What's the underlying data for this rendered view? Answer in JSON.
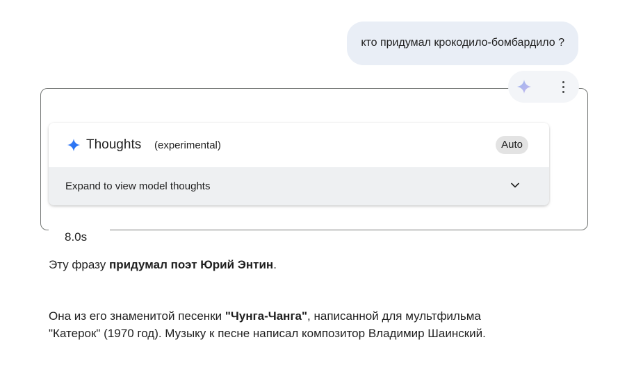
{
  "user_message": {
    "text": "кто придумал крокодило-бомбардило ?"
  },
  "response_actions": {
    "spark_icon": "gemini-spark-icon",
    "more_icon": "more-vertical-icon"
  },
  "thoughts": {
    "title": "Thoughts",
    "subtitle": "(experimental)",
    "mode_badge": "Auto",
    "expand_label": "Expand to view model thoughts",
    "expand_icon": "chevron-down-icon",
    "accent_color": "#4285f4"
  },
  "elapsed_time": "8.0s",
  "answer": {
    "p1_prefix": "Эту фразу ",
    "p1_bold": "придумал поэт Юрий Энтин",
    "p1_suffix": ".",
    "p2_prefix": "Она из его знаменитой песенки ",
    "p2_bold": "\"Чунга-Чанга\"",
    "p2_suffix": ", написанной для мультфильма \"Катерок\" (1970 год). Музыку к песне написал композитор Владимир Шаинский."
  }
}
